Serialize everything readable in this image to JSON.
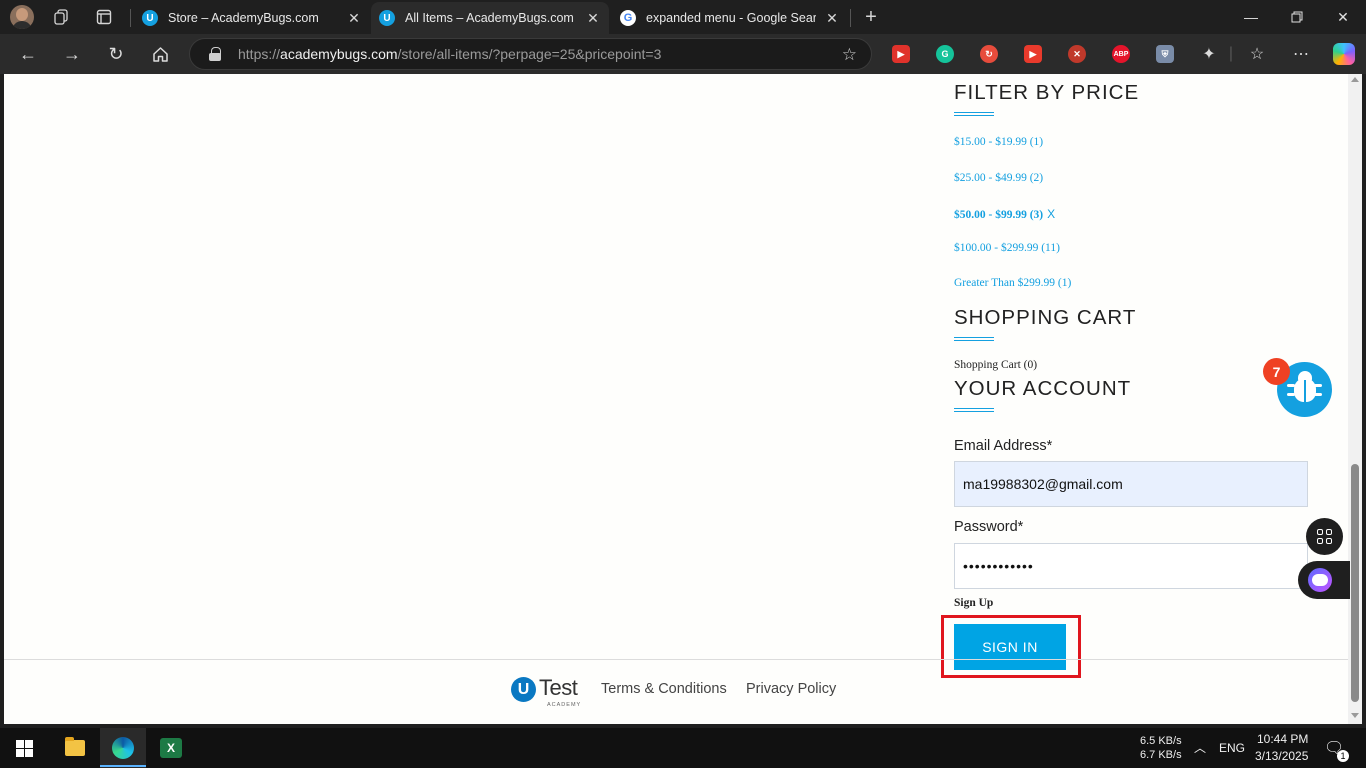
{
  "browser": {
    "tabs": [
      {
        "title": "Store – AcademyBugs.com",
        "favicon": "u-icon"
      },
      {
        "title": "All Items – AcademyBugs.com",
        "favicon": "u-icon"
      },
      {
        "title": "expanded menu - Google Search",
        "favicon": "google-icon"
      }
    ],
    "url_host": "academybugs.com",
    "url_prefix": "https://",
    "url_path": "/store/all-items/?perpage=25&pricepoint=3",
    "extensions": [
      {
        "name": "video-speed-icon",
        "color": "#e0322b"
      },
      {
        "name": "grammarly-icon",
        "color": "#15c39a"
      },
      {
        "name": "rest-icon",
        "color": "#e74c3c"
      },
      {
        "name": "bookmark-icon",
        "color": "#e93a2c"
      },
      {
        "name": "blocker-icon",
        "color": "#c0392b"
      },
      {
        "name": "adblock-plus-icon",
        "color": "#e5142b"
      },
      {
        "name": "shield-icon",
        "color": "#7a8ca8"
      }
    ]
  },
  "sidebar": {
    "filter_title": "FILTER BY PRICE",
    "price_filters": [
      {
        "label": "$15.00 - $19.99 (1)",
        "selected": false
      },
      {
        "label": "$25.00 - $49.99 (2)",
        "selected": false
      },
      {
        "label": "$50.00 - $99.99 (3)",
        "selected": true
      },
      {
        "label": "$100.00 - $299.99 (11)",
        "selected": false
      },
      {
        "label": "Greater Than $299.99 (1)",
        "selected": false
      }
    ],
    "remove_filter": "X",
    "cart_title": "SHOPPING CART",
    "cart_text": "Shopping Cart (0)",
    "account_title": "YOUR ACCOUNT",
    "email_label": "Email Address*",
    "email_value": "ma19988302@gmail.com",
    "password_label": "Password*",
    "password_value": "••••••••••••",
    "signup_label": "Sign Up",
    "signin_label": "SIGN IN"
  },
  "footer": {
    "logo_letter": "U",
    "logo_word": "Test",
    "logo_sub": "ACADEMY",
    "terms": "Terms & Conditions",
    "privacy": "Privacy Policy"
  },
  "widgets": {
    "bug_badge": "7"
  },
  "taskbar": {
    "net_up": "6.5 KB/s",
    "net_down": "6.7 KB/s",
    "language": "ENG",
    "time": "10:44 PM",
    "date": "3/13/2025",
    "notifications": "1"
  },
  "colors": {
    "accent": "#14a0e0",
    "signin_button": "#00a4e4",
    "highlight": "#e0161e"
  }
}
